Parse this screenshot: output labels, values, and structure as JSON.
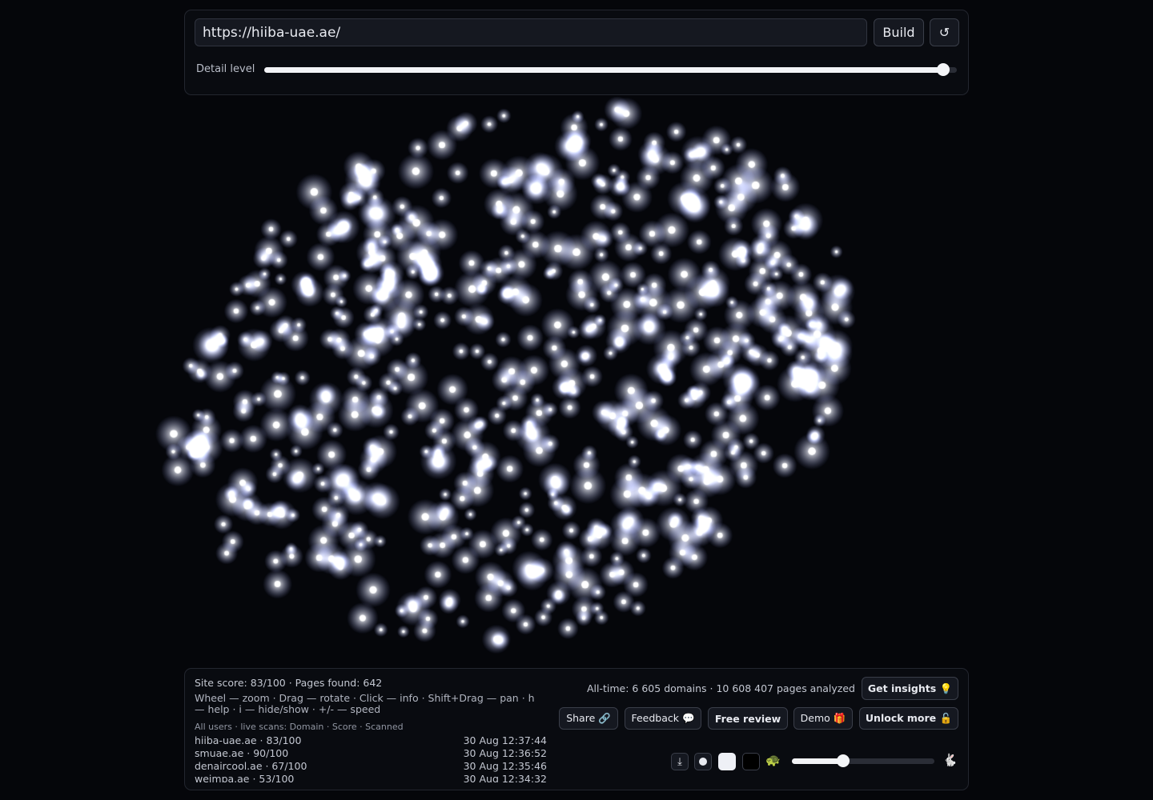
{
  "toolbar": {
    "url_value": "https://hiiba-uae.ae/",
    "build_label": "Build",
    "refresh_icon": "↺",
    "detail_label": "Detail level",
    "detail_level": 0.98
  },
  "visualization": {
    "glow_color": "#dfe3ff",
    "core_color": "#ffffff"
  },
  "footer": {
    "stats": "Site score: 83/100 · Pages found: 642",
    "help": "Wheel — zoom · Drag — rotate · Click — info · Shift+Drag — pan · h — help · i — hide/show · +/- — speed",
    "scans_header": "All users · live scans: Domain · Score · Scanned",
    "scans": [
      {
        "domain": "hiiba-uae.ae · 83/100",
        "time": "30 Aug 12:37:44"
      },
      {
        "domain": "smuae.ae · 90/100",
        "time": "30 Aug 12:36:52"
      },
      {
        "domain": "denaircool.ae · 67/100",
        "time": "30 Aug 12:35:46"
      },
      {
        "domain": "weimpa.ae · 53/100",
        "time": "30 Aug 12:34:32"
      }
    ],
    "alltime": "All-time: 6 605 domains · 10 608 407 pages analyzed",
    "insights_label": "Get insights 💡",
    "share_label": "Share 🔗",
    "feedback_label": "Feedback 💬",
    "review_label": "Free review",
    "demo_label": "Demo 🎁",
    "unlock_label": "Unlock more 🔓",
    "download_icon": "⤓",
    "turtle_icon": "🐢",
    "rabbit_icon": "🐇",
    "speed_level": 0.36
  }
}
